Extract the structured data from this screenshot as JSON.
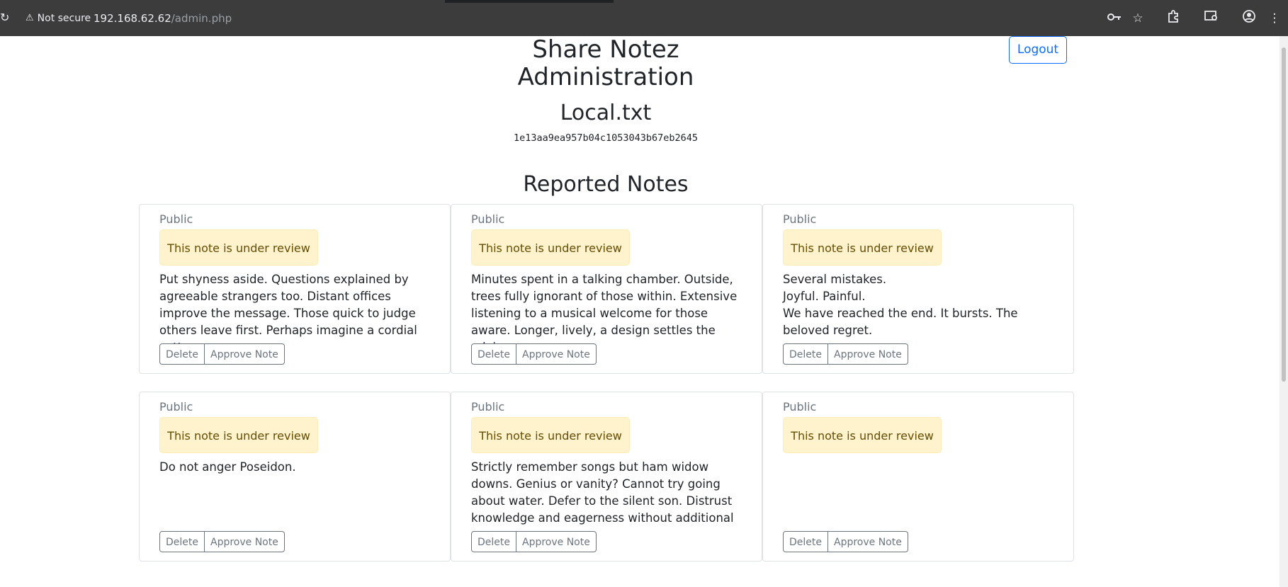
{
  "browser": {
    "security_label": "Not secure",
    "url_host": "192.168.62.62",
    "url_path": "/admin.php"
  },
  "header": {
    "title_line1": "Share Notez",
    "title_line2": "Administration",
    "logout_label": "Logout"
  },
  "local": {
    "filename": "Local.txt",
    "hash": "1e13aa9ea957b04c1053043b67eb2645"
  },
  "reported": {
    "heading": "Reported Notes",
    "notes": [
      {
        "visibility": "Public",
        "status": "This note is under review",
        "body": "Put shyness aside. Questions explained by agreeable strangers too. Distant offices improve the message. Those quick to judge others leave first. Perhaps imagine a cordial cottage.",
        "delete_label": "Delete",
        "approve_label": "Approve Note"
      },
      {
        "visibility": "Public",
        "status": "This note is under review",
        "body": "Minutes spent in a talking chamber. Outside, trees fully ignorant of those within. Extensive listening to a musical welcome for those aware. Longer, lively, a design settles the advice.",
        "delete_label": "Delete",
        "approve_label": "Approve Note"
      },
      {
        "visibility": "Public",
        "status": "This note is under review",
        "body": "Several mistakes.\nJoyful. Painful.\nWe have reached the end. It bursts. The beloved regret.",
        "delete_label": "Delete",
        "approve_label": "Approve Note"
      },
      {
        "visibility": "Public",
        "status": "This note is under review",
        "body": "Do not anger Poseidon.",
        "delete_label": "Delete",
        "approve_label": "Approve Note"
      },
      {
        "visibility": "Public",
        "status": "This note is under review",
        "body": "Strictly remember songs but ham widow downs. Genius or vanity? Cannot try going about water. Defer to the silent son. Distrust knowledge and eagerness without additional assurances",
        "delete_label": "Delete",
        "approve_label": "Approve Note"
      },
      {
        "visibility": "Public",
        "status": "This note is under review",
        "body": "",
        "delete_label": "Delete",
        "approve_label": "Approve Note"
      }
    ]
  }
}
